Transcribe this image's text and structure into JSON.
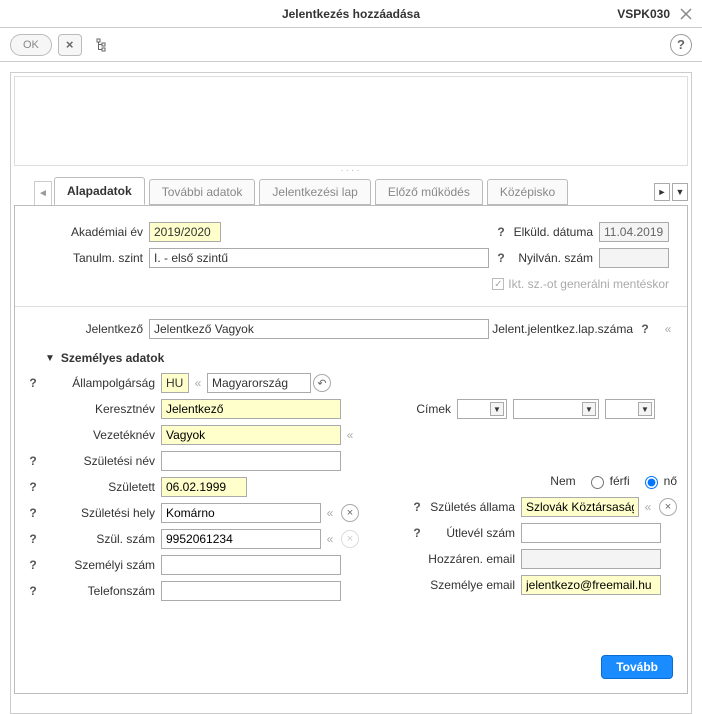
{
  "window": {
    "title": "Jelentkezés hozzáadása",
    "code": "VSPK030"
  },
  "toolbar": {
    "ok": "OK"
  },
  "tabs": {
    "items": [
      "Alapadatok",
      "További adatok",
      "Jelentkezési lap",
      "Előző működés",
      "Középisko"
    ],
    "active": 0
  },
  "top": {
    "akad_ev_label": "Akadémiai év",
    "akad_ev_value": "2019/2020",
    "tanulm_szint_label": "Tanulm. szint",
    "tanulm_szint_value": "I. - első szintű",
    "elkuld_label": "Elküld. dátuma",
    "elkuld_value": "11.04.2019",
    "nyilvan_label": "Nyilván. szám",
    "nyilvan_value": "",
    "checkbox_label": "Ikt. sz.-ot generálni mentéskor",
    "jelentkezo_label": "Jelentkező",
    "jelentkezo_value": "Jelentkező Vagyok",
    "jelent_lap_label": "Jelent.jelentkez.lap.száma"
  },
  "section_title": "Személyes adatok",
  "left": {
    "allampolg_label": "Állampolgárság",
    "allampolg_code": "HU",
    "allampolg_country": "Magyarország",
    "keresztnev_label": "Keresztnév",
    "keresztnev_value": "Jelentkező",
    "vezeteknev_label": "Vezetéknév",
    "vezeteknev_value": "Vagyok",
    "szulnev_label": "Születési név",
    "szulnev_value": "",
    "szuletett_label": "Született",
    "szuletett_value": "06.02.1999",
    "szulhely_label": "Születési hely",
    "szulhely_value": "Komárno",
    "szulszam_label": "Szül. szám",
    "szulszam_value": "9952061234",
    "szemszam_label": "Személyi szám",
    "szemszam_value": "",
    "telefon_label": "Telefonszám",
    "telefon_value": ""
  },
  "right": {
    "cimek_label": "Címek",
    "nem_label": "Nem",
    "nem_ferfi": "férfi",
    "nem_no": "nő",
    "nem_value": "nő",
    "szul_allama_label": "Születés állama",
    "szul_allama_value": "Szlovák Köztársaság",
    "utlevel_label": "Útlevél szám",
    "utlevel_value": "",
    "hozzaren_label": "Hozzáren. email",
    "hozzaren_value": "",
    "szem_email_label": "Személye email",
    "szem_email_value": "jelentkezo@freemail.hu"
  },
  "footer": {
    "tovabb": "Tovább"
  },
  "glyph": {
    "q": "?",
    "chev_left": "«",
    "chev_right": "&#9658;",
    "drop": "&#9662;",
    "undo": "↶",
    "del": "×",
    "check": "✓",
    "tri": "▼"
  }
}
